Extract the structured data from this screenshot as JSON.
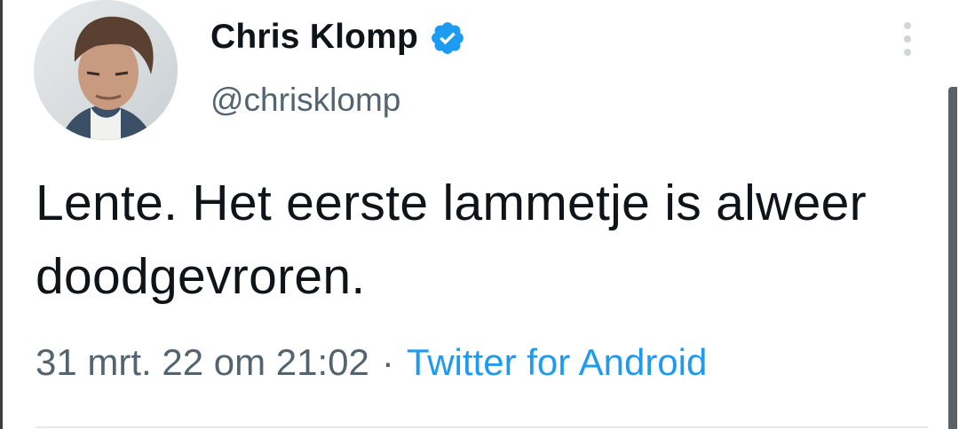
{
  "tweet": {
    "author": {
      "display_name": "Chris Klomp",
      "handle": "@chrisklomp",
      "verified": true
    },
    "text": "Lente. Het eerste lammetje is alweer doodgevroren.",
    "timestamp": "31 mrt. 22 om 21:02",
    "separator": "·",
    "source": "Twitter for Android"
  },
  "icons": {
    "verified": "verified-badge-icon",
    "more": "more-vertical-icon"
  },
  "colors": {
    "text_primary": "#0f1419",
    "text_secondary": "#536471",
    "accent": "#1d9bf0",
    "verified_badge": "#1d9bf0"
  }
}
